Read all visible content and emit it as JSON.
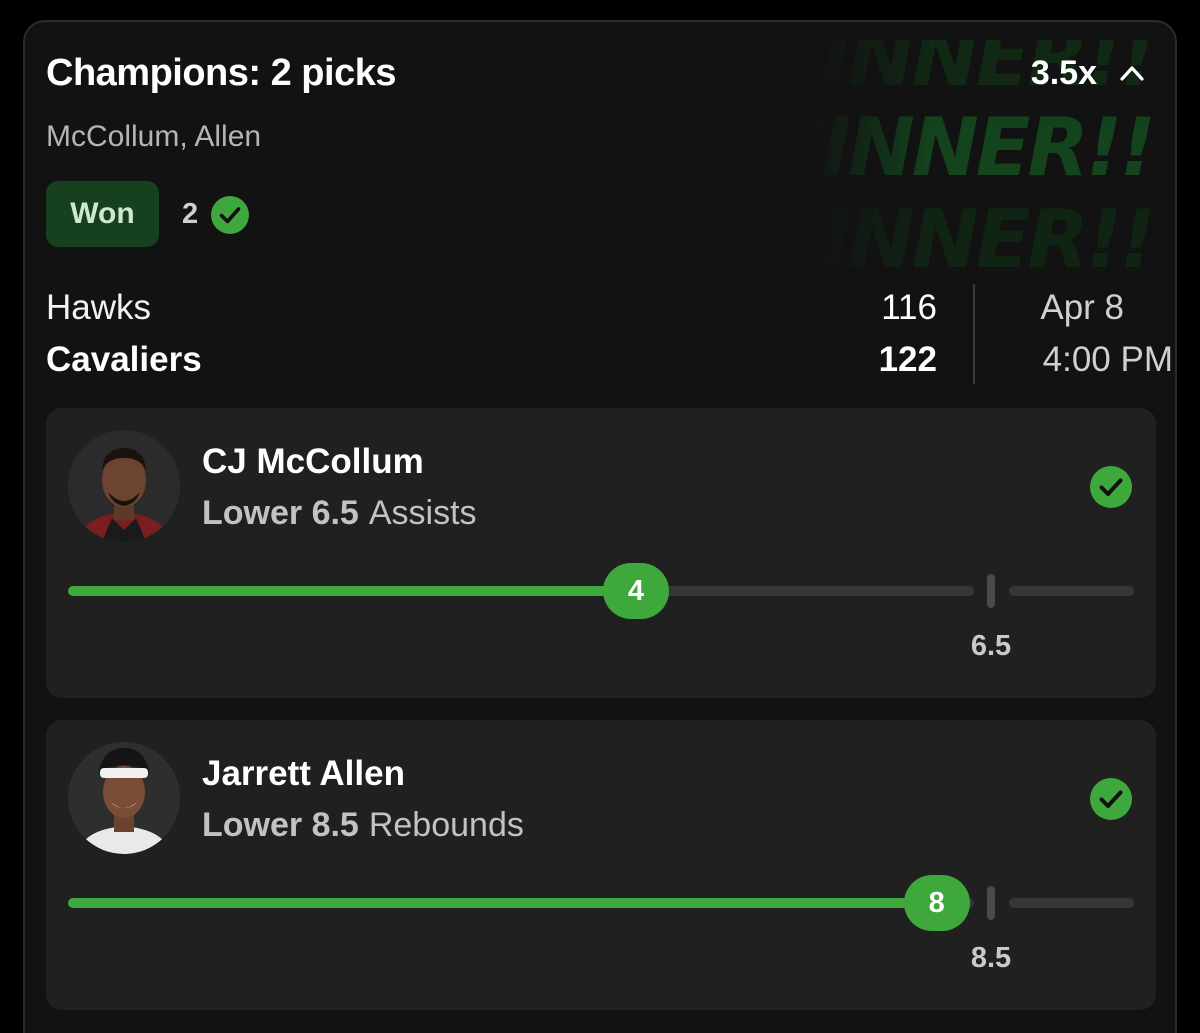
{
  "header": {
    "title": "Champions: 2 picks",
    "multiplier": "3.5x",
    "subtitle": "McCollum, Allen",
    "status": "Won",
    "wins": "2",
    "watermark": [
      "WINNER!!",
      "WINNER!!",
      "WINNER!!"
    ]
  },
  "game": {
    "team1": "Hawks",
    "score1": "116",
    "team2": "Cavaliers",
    "score2": "122",
    "date": "Apr 8",
    "time": "4:00 PM"
  },
  "colors": {
    "accent": "#3fa83d",
    "badge_bg": "#17401e",
    "card_bg": "#121212",
    "pick_bg": "#202020"
  },
  "picks": [
    {
      "name": "CJ McCollum",
      "direction": "Lower 6.5",
      "stat": "Assists",
      "value": 4,
      "value_label": "4",
      "line": 6.5,
      "line_label": "6.5",
      "scale_max": 7.8,
      "avatar_icon": "player-headshot-icon"
    },
    {
      "name": "Jarrett Allen",
      "direction": "Lower 8.5",
      "stat": "Rebounds",
      "value": 8,
      "value_label": "8",
      "line": 8.5,
      "line_label": "8.5",
      "scale_max": 9.6,
      "avatar_icon": "player-headshot-icon"
    }
  ]
}
